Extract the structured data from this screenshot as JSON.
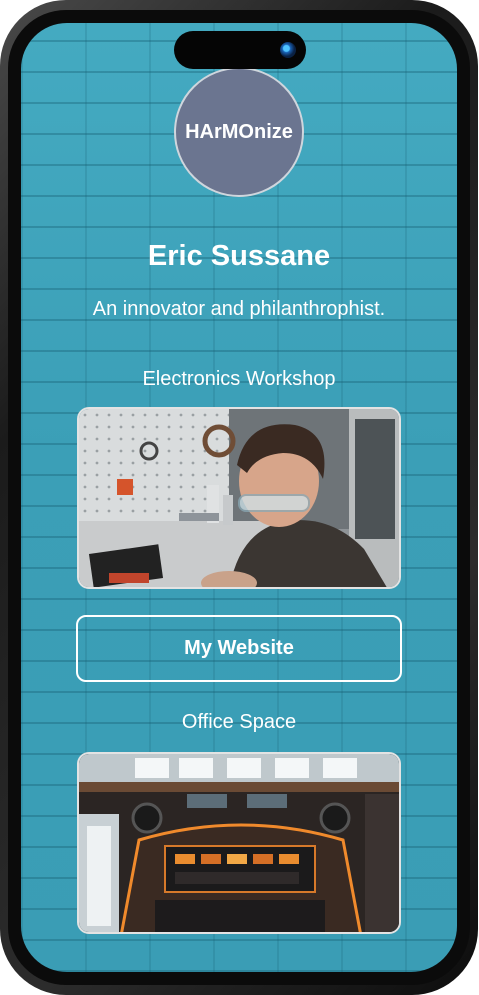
{
  "profile": {
    "avatar_text": "HArMOnize",
    "name": "Eric Sussane",
    "bio": "An innovator and philanthrophist."
  },
  "links": [
    {
      "title": "Electronics Workshop",
      "image_alt": "Man with safety glasses working in an electronics workshop"
    },
    {
      "button_label": "My Website"
    },
    {
      "title": "Office Space",
      "image_alt": "Futuristic office space with control panel and warm lights"
    }
  ],
  "colors": {
    "background": "#3aa1b8",
    "avatar_fill": "#6b7590",
    "text": "#ffffff"
  }
}
